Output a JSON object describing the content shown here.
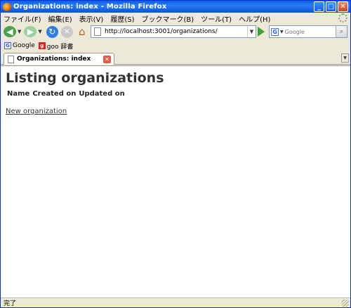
{
  "window": {
    "title": "Organizations: index - Mozilla Firefox",
    "controls": {
      "minimize": "_",
      "maximize": "□",
      "close": "✕"
    }
  },
  "menubar": {
    "items": [
      "ファイル(F)",
      "編集(E)",
      "表示(V)",
      "履歴(S)",
      "ブックマーク(B)",
      "ツール(T)",
      "ヘルプ(H)"
    ]
  },
  "navbar": {
    "url": "http://localhost:3001/organizations/",
    "search_placeholder": "Google"
  },
  "bookmarks": {
    "items": [
      {
        "label": "Google",
        "icon": "google-icon"
      },
      {
        "label": "goo 辞書",
        "icon": "goo-icon"
      }
    ]
  },
  "tab": {
    "label": "Organizations: index"
  },
  "page": {
    "heading": "Listing organizations",
    "columns": [
      "Name",
      "Created on",
      "Updated on"
    ],
    "new_link": "New organization"
  },
  "status": {
    "text": "完了"
  },
  "colors": {
    "titlebar": "#0a5fe0",
    "chrome": "#ece9d8",
    "heading_text": "#333333"
  }
}
